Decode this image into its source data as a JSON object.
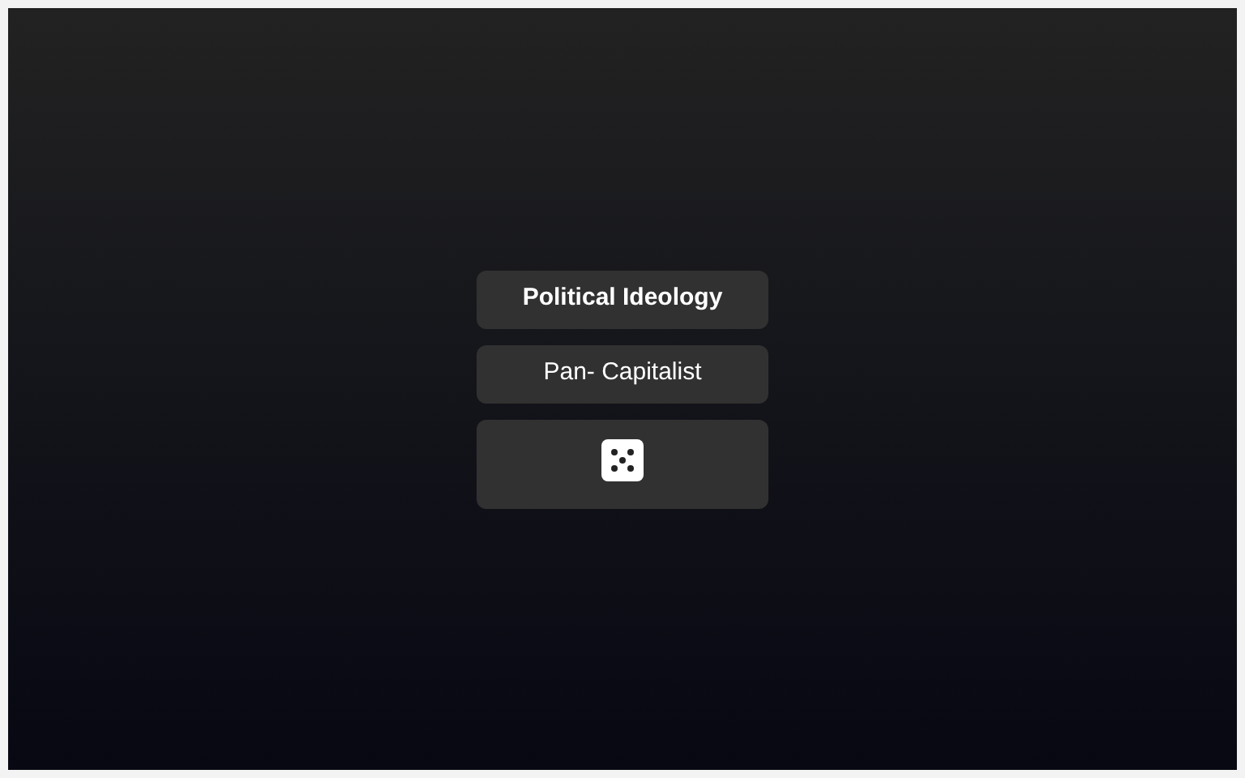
{
  "title": "Political Ideology",
  "result": "Pan- Capitalist"
}
